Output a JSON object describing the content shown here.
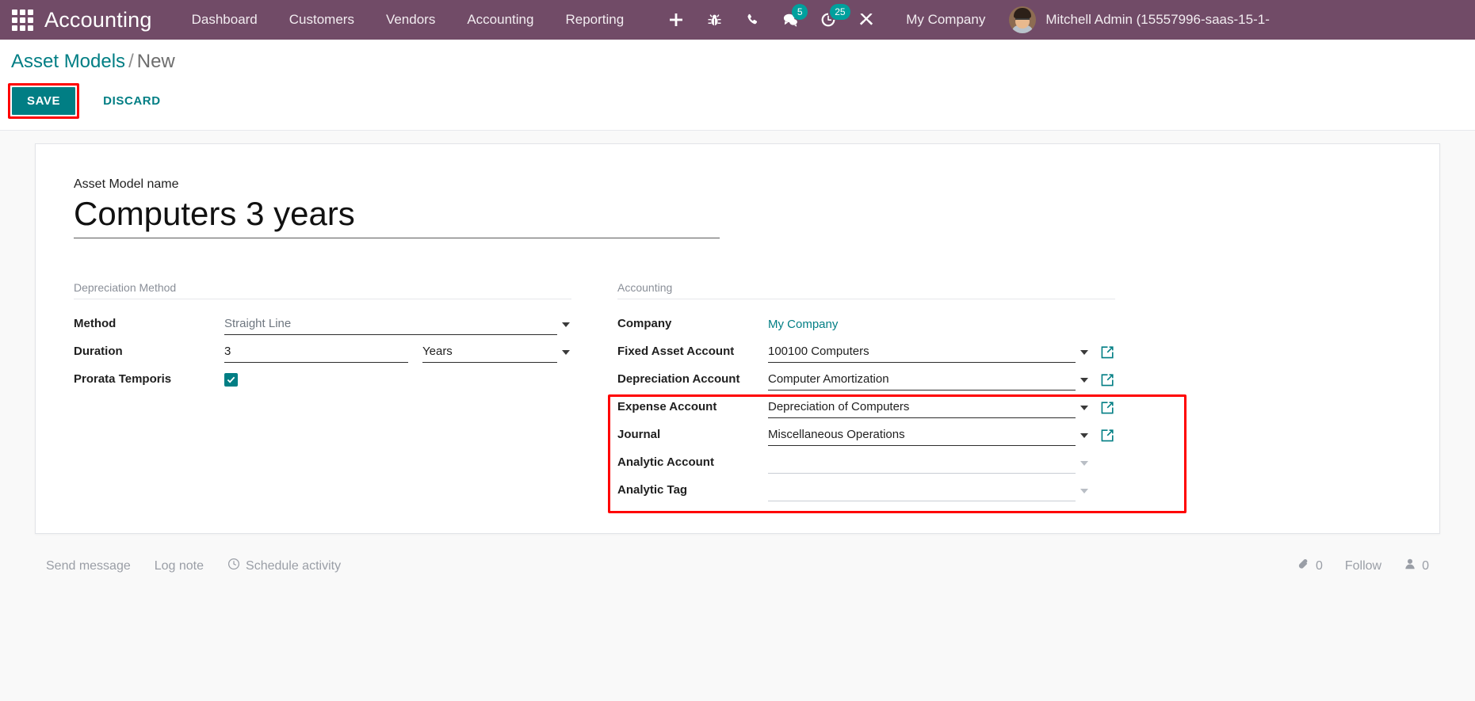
{
  "navbar": {
    "apps_icon": "apps-grid-icon",
    "brand": "Accounting",
    "menus": [
      {
        "label": "Dashboard"
      },
      {
        "label": "Customers"
      },
      {
        "label": "Vendors"
      },
      {
        "label": "Accounting"
      },
      {
        "label": "Reporting"
      }
    ],
    "icons": [
      {
        "name": "plus-icon",
        "badge": ""
      },
      {
        "name": "bug-icon",
        "badge": ""
      },
      {
        "name": "phone-icon",
        "badge": ""
      },
      {
        "name": "chat-icon",
        "badge": "5"
      },
      {
        "name": "activity-clock-icon",
        "badge": "25"
      },
      {
        "name": "tools-wrench-icon",
        "badge": ""
      }
    ],
    "company": "My Company",
    "user": "Mitchell Admin (15557996-saas-15-1-",
    "brand_color": "#714B67",
    "badge_color": "#00A09D"
  },
  "breadcrumb": {
    "root": "Asset Models",
    "separator": "/",
    "current": "New"
  },
  "actions": {
    "save_label": "SAVE",
    "discard_label": "DISCARD",
    "save_color": "#017e84",
    "highlight_color": "#ff0000"
  },
  "form": {
    "title_label": "Asset Model name",
    "title_value": "Computers 3 years",
    "left_group": {
      "title": "Depreciation Method",
      "fields": [
        {
          "label": "Method",
          "value": "Straight Line",
          "type": "select"
        },
        {
          "label": "Duration",
          "value": "3",
          "unit": "Years",
          "type": "number-unit"
        },
        {
          "label": "Prorata Temporis",
          "value": "",
          "type": "checkbox",
          "checked": true
        }
      ]
    },
    "right_group": {
      "title": "Accounting",
      "fields": [
        {
          "label": "Company",
          "value": "My Company",
          "type": "link"
        },
        {
          "label": "Fixed Asset Account",
          "value": "100100 Computers",
          "type": "many2one",
          "external": true
        },
        {
          "label": "Depreciation Account",
          "value": "Computer Amortization",
          "type": "many2one",
          "external": true
        },
        {
          "label": "Expense Account",
          "value": "Depreciation of Computers",
          "type": "many2one",
          "external": true,
          "highlighted": true
        },
        {
          "label": "Journal",
          "value": "Miscellaneous Operations",
          "type": "many2one",
          "external": true,
          "highlighted": true
        },
        {
          "label": "Analytic Account",
          "value": "",
          "type": "many2one",
          "external": false,
          "highlighted": true
        },
        {
          "label": "Analytic Tag",
          "value": "",
          "type": "many2one",
          "external": false,
          "highlighted": true
        }
      ]
    }
  },
  "chatter": {
    "send_message": "Send message",
    "log_note": "Log note",
    "schedule_activity": "Schedule activity",
    "attachment_count": "0",
    "follow_label": "Follow",
    "follower_count": "0"
  }
}
